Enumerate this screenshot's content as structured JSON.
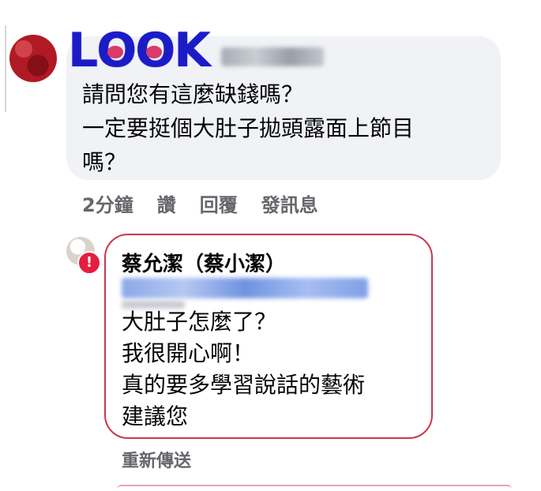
{
  "comment1": {
    "overlay_logo": "LOOK",
    "text": "請問您有這麼缺錢嗎？\n一定要挺個大肚子拋頭露面上節目\n嗎？"
  },
  "actions": {
    "time": "2分鐘",
    "like": "讚",
    "reply": "回覆",
    "message": "發訊息"
  },
  "reply": {
    "author": "蔡允潔（蔡小潔）",
    "text": "大肚子怎麼了？\n我很開心啊！\n真的要多學習說話的藝術\n建議您",
    "status_icon": "!",
    "resend": "重新傳送"
  },
  "colors": {
    "bubble_bg": "#f0f2f5",
    "alert": "#e41e3f",
    "reply_border": "#c8374f",
    "logo": "#1c1cc7"
  }
}
